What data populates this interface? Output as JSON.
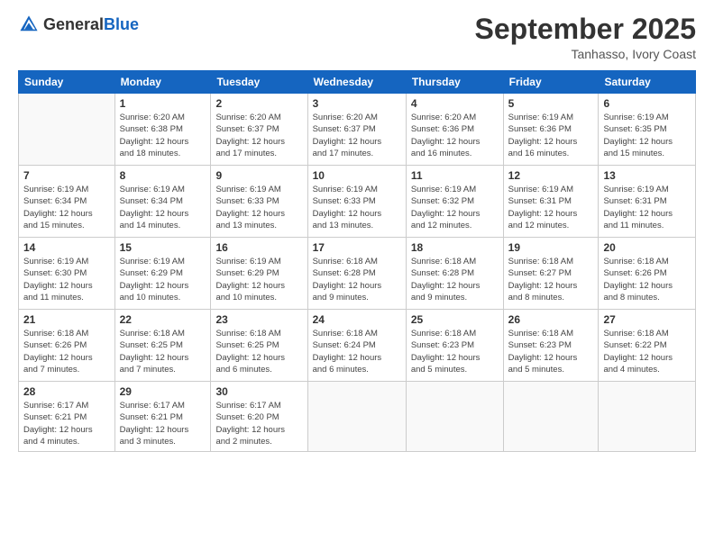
{
  "logo": {
    "general": "General",
    "blue": "Blue"
  },
  "title": "September 2025",
  "location": "Tanhasso, Ivory Coast",
  "headers": [
    "Sunday",
    "Monday",
    "Tuesday",
    "Wednesday",
    "Thursday",
    "Friday",
    "Saturday"
  ],
  "weeks": [
    [
      {
        "day": "",
        "info": ""
      },
      {
        "day": "1",
        "info": "Sunrise: 6:20 AM\nSunset: 6:38 PM\nDaylight: 12 hours\nand 18 minutes."
      },
      {
        "day": "2",
        "info": "Sunrise: 6:20 AM\nSunset: 6:37 PM\nDaylight: 12 hours\nand 17 minutes."
      },
      {
        "day": "3",
        "info": "Sunrise: 6:20 AM\nSunset: 6:37 PM\nDaylight: 12 hours\nand 17 minutes."
      },
      {
        "day": "4",
        "info": "Sunrise: 6:20 AM\nSunset: 6:36 PM\nDaylight: 12 hours\nand 16 minutes."
      },
      {
        "day": "5",
        "info": "Sunrise: 6:19 AM\nSunset: 6:36 PM\nDaylight: 12 hours\nand 16 minutes."
      },
      {
        "day": "6",
        "info": "Sunrise: 6:19 AM\nSunset: 6:35 PM\nDaylight: 12 hours\nand 15 minutes."
      }
    ],
    [
      {
        "day": "7",
        "info": "Sunrise: 6:19 AM\nSunset: 6:34 PM\nDaylight: 12 hours\nand 15 minutes."
      },
      {
        "day": "8",
        "info": "Sunrise: 6:19 AM\nSunset: 6:34 PM\nDaylight: 12 hours\nand 14 minutes."
      },
      {
        "day": "9",
        "info": "Sunrise: 6:19 AM\nSunset: 6:33 PM\nDaylight: 12 hours\nand 13 minutes."
      },
      {
        "day": "10",
        "info": "Sunrise: 6:19 AM\nSunset: 6:33 PM\nDaylight: 12 hours\nand 13 minutes."
      },
      {
        "day": "11",
        "info": "Sunrise: 6:19 AM\nSunset: 6:32 PM\nDaylight: 12 hours\nand 12 minutes."
      },
      {
        "day": "12",
        "info": "Sunrise: 6:19 AM\nSunset: 6:31 PM\nDaylight: 12 hours\nand 12 minutes."
      },
      {
        "day": "13",
        "info": "Sunrise: 6:19 AM\nSunset: 6:31 PM\nDaylight: 12 hours\nand 11 minutes."
      }
    ],
    [
      {
        "day": "14",
        "info": "Sunrise: 6:19 AM\nSunset: 6:30 PM\nDaylight: 12 hours\nand 11 minutes."
      },
      {
        "day": "15",
        "info": "Sunrise: 6:19 AM\nSunset: 6:29 PM\nDaylight: 12 hours\nand 10 minutes."
      },
      {
        "day": "16",
        "info": "Sunrise: 6:19 AM\nSunset: 6:29 PM\nDaylight: 12 hours\nand 10 minutes."
      },
      {
        "day": "17",
        "info": "Sunrise: 6:18 AM\nSunset: 6:28 PM\nDaylight: 12 hours\nand 9 minutes."
      },
      {
        "day": "18",
        "info": "Sunrise: 6:18 AM\nSunset: 6:28 PM\nDaylight: 12 hours\nand 9 minutes."
      },
      {
        "day": "19",
        "info": "Sunrise: 6:18 AM\nSunset: 6:27 PM\nDaylight: 12 hours\nand 8 minutes."
      },
      {
        "day": "20",
        "info": "Sunrise: 6:18 AM\nSunset: 6:26 PM\nDaylight: 12 hours\nand 8 minutes."
      }
    ],
    [
      {
        "day": "21",
        "info": "Sunrise: 6:18 AM\nSunset: 6:26 PM\nDaylight: 12 hours\nand 7 minutes."
      },
      {
        "day": "22",
        "info": "Sunrise: 6:18 AM\nSunset: 6:25 PM\nDaylight: 12 hours\nand 7 minutes."
      },
      {
        "day": "23",
        "info": "Sunrise: 6:18 AM\nSunset: 6:25 PM\nDaylight: 12 hours\nand 6 minutes."
      },
      {
        "day": "24",
        "info": "Sunrise: 6:18 AM\nSunset: 6:24 PM\nDaylight: 12 hours\nand 6 minutes."
      },
      {
        "day": "25",
        "info": "Sunrise: 6:18 AM\nSunset: 6:23 PM\nDaylight: 12 hours\nand 5 minutes."
      },
      {
        "day": "26",
        "info": "Sunrise: 6:18 AM\nSunset: 6:23 PM\nDaylight: 12 hours\nand 5 minutes."
      },
      {
        "day": "27",
        "info": "Sunrise: 6:18 AM\nSunset: 6:22 PM\nDaylight: 12 hours\nand 4 minutes."
      }
    ],
    [
      {
        "day": "28",
        "info": "Sunrise: 6:17 AM\nSunset: 6:21 PM\nDaylight: 12 hours\nand 4 minutes."
      },
      {
        "day": "29",
        "info": "Sunrise: 6:17 AM\nSunset: 6:21 PM\nDaylight: 12 hours\nand 3 minutes."
      },
      {
        "day": "30",
        "info": "Sunrise: 6:17 AM\nSunset: 6:20 PM\nDaylight: 12 hours\nand 2 minutes."
      },
      {
        "day": "",
        "info": ""
      },
      {
        "day": "",
        "info": ""
      },
      {
        "day": "",
        "info": ""
      },
      {
        "day": "",
        "info": ""
      }
    ]
  ]
}
